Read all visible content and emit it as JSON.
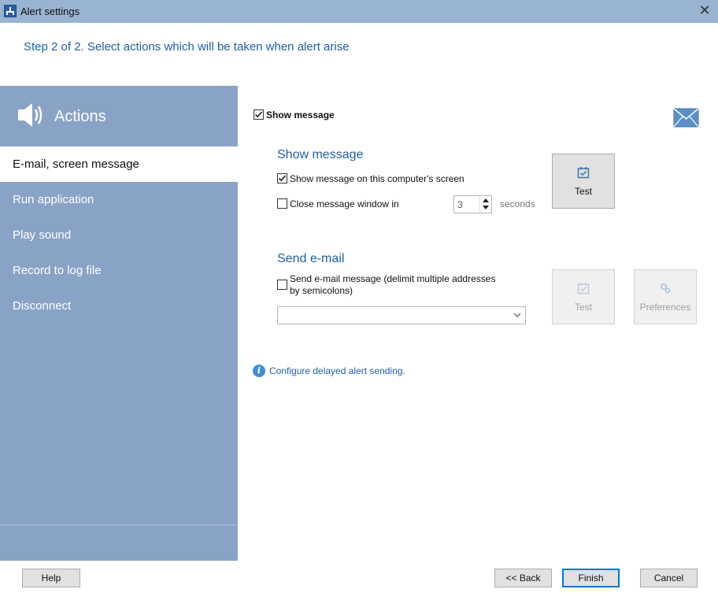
{
  "window": {
    "title": "Alert settings",
    "close_glyph": "✕"
  },
  "header": {
    "step_text": "Step 2 of 2. Select actions which will be taken when alert arise"
  },
  "sidebar": {
    "title": "Actions",
    "icon": "speaker-icon",
    "items": [
      {
        "label": "E-mail, screen message",
        "active": true
      },
      {
        "label": "Run application",
        "active": false
      },
      {
        "label": "Play sound",
        "active": false
      },
      {
        "label": "Record to log file",
        "active": false
      },
      {
        "label": "Disconnect",
        "active": false
      }
    ]
  },
  "main": {
    "show_message_toggle": {
      "label": "Show message",
      "checked": true
    },
    "show_message_section": {
      "title": "Show message",
      "on_screen": {
        "label": "Show message on this computer's screen",
        "checked": true
      },
      "close_window": {
        "label": "Close message window in",
        "checked": false
      },
      "seconds_value": "3",
      "seconds_unit": "seconds",
      "test_button": "Test"
    },
    "send_email_section": {
      "title": "Send e-mail",
      "send_email": {
        "label_line1": "Send e-mail message (delimit multiple addresses",
        "label_line2": "by semicolons)",
        "checked": false
      },
      "address_value": "",
      "test_button": "Test",
      "preferences_button": "Preferences"
    },
    "info": {
      "icon": "info-icon",
      "glyph": "i",
      "link_text": "Configure delayed alert sending."
    }
  },
  "footer": {
    "help": "Help",
    "back": "<< Back",
    "finish": "Finish",
    "cancel": "Cancel"
  },
  "colors": {
    "titlebar": "#99b4d1",
    "sidebar": "#89a3c6",
    "accent_text": "#1f5fa6"
  }
}
